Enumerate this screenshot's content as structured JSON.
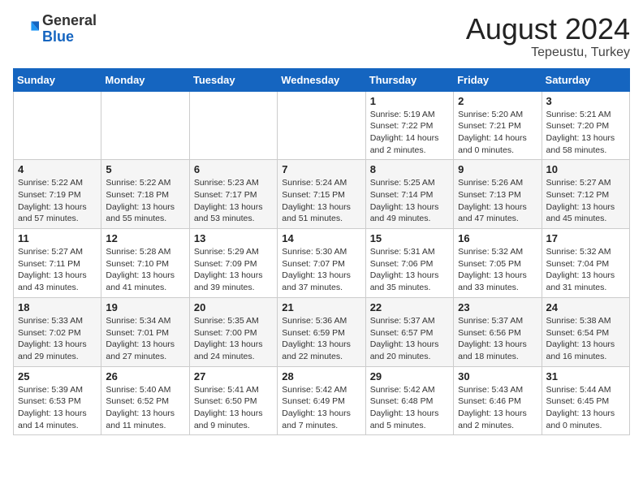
{
  "header": {
    "logo_line1": "General",
    "logo_line2": "Blue",
    "month_year": "August 2024",
    "location": "Tepeustu, Turkey"
  },
  "weekdays": [
    "Sunday",
    "Monday",
    "Tuesday",
    "Wednesday",
    "Thursday",
    "Friday",
    "Saturday"
  ],
  "weeks": [
    [
      {
        "day": "",
        "sunrise": "",
        "sunset": "",
        "daylight": ""
      },
      {
        "day": "",
        "sunrise": "",
        "sunset": "",
        "daylight": ""
      },
      {
        "day": "",
        "sunrise": "",
        "sunset": "",
        "daylight": ""
      },
      {
        "day": "",
        "sunrise": "",
        "sunset": "",
        "daylight": ""
      },
      {
        "day": "1",
        "sunrise": "Sunrise: 5:19 AM",
        "sunset": "Sunset: 7:22 PM",
        "daylight": "Daylight: 14 hours and 2 minutes."
      },
      {
        "day": "2",
        "sunrise": "Sunrise: 5:20 AM",
        "sunset": "Sunset: 7:21 PM",
        "daylight": "Daylight: 14 hours and 0 minutes."
      },
      {
        "day": "3",
        "sunrise": "Sunrise: 5:21 AM",
        "sunset": "Sunset: 7:20 PM",
        "daylight": "Daylight: 13 hours and 58 minutes."
      }
    ],
    [
      {
        "day": "4",
        "sunrise": "Sunrise: 5:22 AM",
        "sunset": "Sunset: 7:19 PM",
        "daylight": "Daylight: 13 hours and 57 minutes."
      },
      {
        "day": "5",
        "sunrise": "Sunrise: 5:22 AM",
        "sunset": "Sunset: 7:18 PM",
        "daylight": "Daylight: 13 hours and 55 minutes."
      },
      {
        "day": "6",
        "sunrise": "Sunrise: 5:23 AM",
        "sunset": "Sunset: 7:17 PM",
        "daylight": "Daylight: 13 hours and 53 minutes."
      },
      {
        "day": "7",
        "sunrise": "Sunrise: 5:24 AM",
        "sunset": "Sunset: 7:15 PM",
        "daylight": "Daylight: 13 hours and 51 minutes."
      },
      {
        "day": "8",
        "sunrise": "Sunrise: 5:25 AM",
        "sunset": "Sunset: 7:14 PM",
        "daylight": "Daylight: 13 hours and 49 minutes."
      },
      {
        "day": "9",
        "sunrise": "Sunrise: 5:26 AM",
        "sunset": "Sunset: 7:13 PM",
        "daylight": "Daylight: 13 hours and 47 minutes."
      },
      {
        "day": "10",
        "sunrise": "Sunrise: 5:27 AM",
        "sunset": "Sunset: 7:12 PM",
        "daylight": "Daylight: 13 hours and 45 minutes."
      }
    ],
    [
      {
        "day": "11",
        "sunrise": "Sunrise: 5:27 AM",
        "sunset": "Sunset: 7:11 PM",
        "daylight": "Daylight: 13 hours and 43 minutes."
      },
      {
        "day": "12",
        "sunrise": "Sunrise: 5:28 AM",
        "sunset": "Sunset: 7:10 PM",
        "daylight": "Daylight: 13 hours and 41 minutes."
      },
      {
        "day": "13",
        "sunrise": "Sunrise: 5:29 AM",
        "sunset": "Sunset: 7:09 PM",
        "daylight": "Daylight: 13 hours and 39 minutes."
      },
      {
        "day": "14",
        "sunrise": "Sunrise: 5:30 AM",
        "sunset": "Sunset: 7:07 PM",
        "daylight": "Daylight: 13 hours and 37 minutes."
      },
      {
        "day": "15",
        "sunrise": "Sunrise: 5:31 AM",
        "sunset": "Sunset: 7:06 PM",
        "daylight": "Daylight: 13 hours and 35 minutes."
      },
      {
        "day": "16",
        "sunrise": "Sunrise: 5:32 AM",
        "sunset": "Sunset: 7:05 PM",
        "daylight": "Daylight: 13 hours and 33 minutes."
      },
      {
        "day": "17",
        "sunrise": "Sunrise: 5:32 AM",
        "sunset": "Sunset: 7:04 PM",
        "daylight": "Daylight: 13 hours and 31 minutes."
      }
    ],
    [
      {
        "day": "18",
        "sunrise": "Sunrise: 5:33 AM",
        "sunset": "Sunset: 7:02 PM",
        "daylight": "Daylight: 13 hours and 29 minutes."
      },
      {
        "day": "19",
        "sunrise": "Sunrise: 5:34 AM",
        "sunset": "Sunset: 7:01 PM",
        "daylight": "Daylight: 13 hours and 27 minutes."
      },
      {
        "day": "20",
        "sunrise": "Sunrise: 5:35 AM",
        "sunset": "Sunset: 7:00 PM",
        "daylight": "Daylight: 13 hours and 24 minutes."
      },
      {
        "day": "21",
        "sunrise": "Sunrise: 5:36 AM",
        "sunset": "Sunset: 6:59 PM",
        "daylight": "Daylight: 13 hours and 22 minutes."
      },
      {
        "day": "22",
        "sunrise": "Sunrise: 5:37 AM",
        "sunset": "Sunset: 6:57 PM",
        "daylight": "Daylight: 13 hours and 20 minutes."
      },
      {
        "day": "23",
        "sunrise": "Sunrise: 5:37 AM",
        "sunset": "Sunset: 6:56 PM",
        "daylight": "Daylight: 13 hours and 18 minutes."
      },
      {
        "day": "24",
        "sunrise": "Sunrise: 5:38 AM",
        "sunset": "Sunset: 6:54 PM",
        "daylight": "Daylight: 13 hours and 16 minutes."
      }
    ],
    [
      {
        "day": "25",
        "sunrise": "Sunrise: 5:39 AM",
        "sunset": "Sunset: 6:53 PM",
        "daylight": "Daylight: 13 hours and 14 minutes."
      },
      {
        "day": "26",
        "sunrise": "Sunrise: 5:40 AM",
        "sunset": "Sunset: 6:52 PM",
        "daylight": "Daylight: 13 hours and 11 minutes."
      },
      {
        "day": "27",
        "sunrise": "Sunrise: 5:41 AM",
        "sunset": "Sunset: 6:50 PM",
        "daylight": "Daylight: 13 hours and 9 minutes."
      },
      {
        "day": "28",
        "sunrise": "Sunrise: 5:42 AM",
        "sunset": "Sunset: 6:49 PM",
        "daylight": "Daylight: 13 hours and 7 minutes."
      },
      {
        "day": "29",
        "sunrise": "Sunrise: 5:42 AM",
        "sunset": "Sunset: 6:48 PM",
        "daylight": "Daylight: 13 hours and 5 minutes."
      },
      {
        "day": "30",
        "sunrise": "Sunrise: 5:43 AM",
        "sunset": "Sunset: 6:46 PM",
        "daylight": "Daylight: 13 hours and 2 minutes."
      },
      {
        "day": "31",
        "sunrise": "Sunrise: 5:44 AM",
        "sunset": "Sunset: 6:45 PM",
        "daylight": "Daylight: 13 hours and 0 minutes."
      }
    ]
  ]
}
